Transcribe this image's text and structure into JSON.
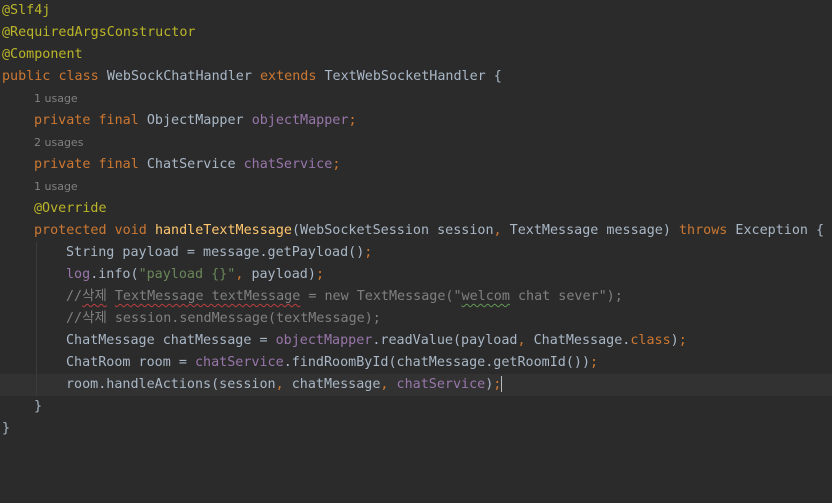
{
  "colors": {
    "background": "#2b2b2b",
    "current_line": "#323232",
    "default": "#a9b7c6",
    "keyword": "#cc7832",
    "annotation": "#bbb529",
    "field": "#9876aa",
    "method_decl": "#ffc66d",
    "string": "#6a8759",
    "comment": "#808080",
    "hint": "#808080"
  },
  "editor": {
    "lines": [
      {
        "kind": "code",
        "tokens": [
          [
            "@Slf4j",
            "annotation"
          ]
        ]
      },
      {
        "kind": "code",
        "tokens": [
          [
            "@RequiredArgsConstructor",
            "annotation"
          ]
        ]
      },
      {
        "kind": "code",
        "tokens": [
          [
            "@Component",
            "annotation"
          ]
        ]
      },
      {
        "kind": "code",
        "tokens": [
          [
            "public ",
            "keyword"
          ],
          [
            "class ",
            "keyword"
          ],
          [
            "WebSockChatHandler ",
            "default"
          ],
          [
            "extends ",
            "keyword"
          ],
          [
            "TextWebSocketHandler {",
            "default"
          ]
        ]
      },
      {
        "kind": "hint",
        "indent": 1,
        "text": "1 usage"
      },
      {
        "kind": "code",
        "indent": 1,
        "tokens": [
          [
            "private ",
            "keyword"
          ],
          [
            "final ",
            "keyword"
          ],
          [
            "ObjectMapper ",
            "default"
          ],
          [
            "objectMapper",
            "field"
          ],
          [
            ";",
            "keyword"
          ]
        ]
      },
      {
        "kind": "hint",
        "indent": 1,
        "text": "2 usages"
      },
      {
        "kind": "code",
        "indent": 1,
        "tokens": [
          [
            "private ",
            "keyword"
          ],
          [
            "final ",
            "keyword"
          ],
          [
            "ChatService ",
            "default"
          ],
          [
            "chatService",
            "field"
          ],
          [
            ";",
            "keyword"
          ]
        ]
      },
      {
        "kind": "hint",
        "indent": 1,
        "text": "1 usage"
      },
      {
        "kind": "code",
        "indent": 1,
        "tokens": [
          [
            "@Override",
            "annotation"
          ]
        ]
      },
      {
        "kind": "code",
        "indent": 1,
        "tokens": [
          [
            "protected ",
            "keyword"
          ],
          [
            "void ",
            "keyword"
          ],
          [
            "handleTextMessage",
            "method_decl"
          ],
          [
            "(WebSocketSession session",
            "default"
          ],
          [
            ", ",
            "keyword"
          ],
          [
            "TextMessage message) ",
            "default"
          ],
          [
            "throws ",
            "keyword"
          ],
          [
            "Exception {",
            "default"
          ]
        ]
      },
      {
        "kind": "code",
        "indent": 2,
        "tokens": [
          [
            "String payload = message.getPayload()",
            "default"
          ],
          [
            ";",
            "keyword"
          ]
        ]
      },
      {
        "kind": "code",
        "indent": 2,
        "tokens": [
          [
            "log",
            "field"
          ],
          [
            ".info(",
            "default"
          ],
          [
            "\"payload {}\"",
            "string"
          ],
          [
            ", ",
            "keyword"
          ],
          [
            "payload)",
            "default"
          ],
          [
            ";",
            "keyword"
          ]
        ]
      },
      {
        "kind": "code",
        "indent": 2,
        "tokens": [
          [
            "//",
            "comment"
          ],
          [
            "삭제",
            "comment-squiggle"
          ],
          [
            " ",
            "comment"
          ],
          [
            "TextMessage textMessage",
            "comment-squiggle"
          ],
          [
            " = new TextMessage(\"",
            "comment"
          ],
          [
            "welcom",
            "comment-squiggle-green"
          ],
          [
            " chat sever\");",
            "comment"
          ]
        ]
      },
      {
        "kind": "code",
        "indent": 2,
        "tokens": [
          [
            "//삭제 session.sendMessage(textMessage);",
            "comment"
          ]
        ]
      },
      {
        "kind": "code",
        "indent": 2,
        "tokens": [
          [
            "ChatMessage chatMessage = ",
            "default"
          ],
          [
            "objectMapper",
            "field"
          ],
          [
            ".readValue(payload",
            "default"
          ],
          [
            ", ",
            "keyword"
          ],
          [
            "ChatMessage.",
            "default"
          ],
          [
            "class",
            "keyword"
          ],
          [
            ")",
            "default"
          ],
          [
            ";",
            "keyword"
          ]
        ]
      },
      {
        "kind": "code",
        "indent": 2,
        "tokens": [
          [
            "ChatRoom room = ",
            "default"
          ],
          [
            "chatService",
            "field"
          ],
          [
            ".findRoomById(chatMessage.getRoomId())",
            "default"
          ],
          [
            ";",
            "keyword"
          ]
        ]
      },
      {
        "kind": "code",
        "indent": 2,
        "current": true,
        "caret": true,
        "tokens": [
          [
            "room.handleActions(session",
            "default"
          ],
          [
            ", ",
            "keyword"
          ],
          [
            "chatMessage",
            "default"
          ],
          [
            ", ",
            "keyword"
          ],
          [
            "chatService",
            "field"
          ],
          [
            ")",
            "default"
          ],
          [
            ";",
            "keyword"
          ]
        ]
      },
      {
        "kind": "code",
        "indent": 1,
        "tokens": [
          [
            "}",
            "default"
          ]
        ]
      },
      {
        "kind": "code",
        "tokens": [
          [
            "}",
            "default"
          ]
        ]
      }
    ]
  }
}
